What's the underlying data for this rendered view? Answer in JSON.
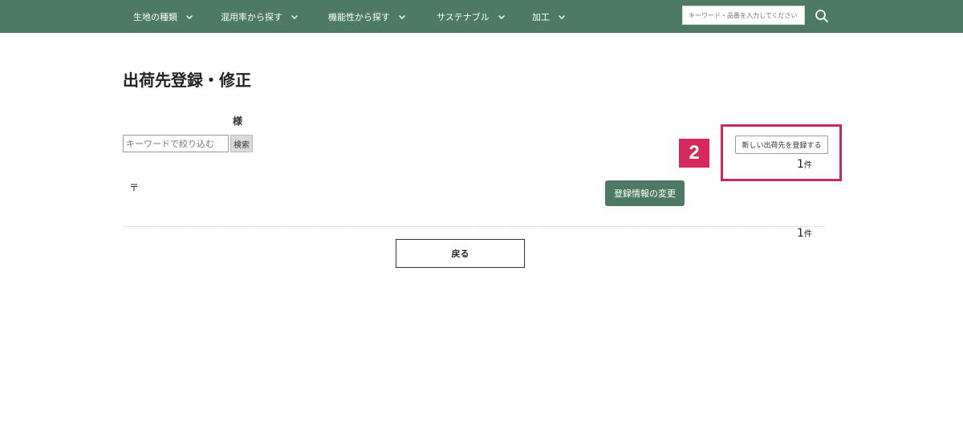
{
  "colors": {
    "brand_green": "#4e7a63",
    "highlight": "#c8285f",
    "badge": "#d62a5e"
  },
  "nav": {
    "items": [
      {
        "label": "生地の種類",
        "icon": "chevron-down-icon"
      },
      {
        "label": "混用率から探す",
        "icon": "chevron-down-icon"
      },
      {
        "label": "機能性から探す",
        "icon": "chevron-down-icon"
      },
      {
        "label": "サステナブル",
        "icon": "chevron-down-icon"
      },
      {
        "label": "加工",
        "icon": "chevron-down-icon"
      }
    ],
    "search_placeholder": "キーワード・品番を入力してください",
    "search_icon": "search-icon"
  },
  "page": {
    "title": "出荷先登録・修正",
    "honorific": "様",
    "keyword_placeholder": "キーワードで絞り込む",
    "filter_button": "検索",
    "step_badge": "2",
    "new_destination_button": "新しい出荷先を登録する",
    "count_top": "1",
    "count_unit": "件",
    "postal_mark": "〒",
    "edit_button": "登録情報の変更",
    "count_bottom": "1",
    "back_button": "戻る"
  }
}
